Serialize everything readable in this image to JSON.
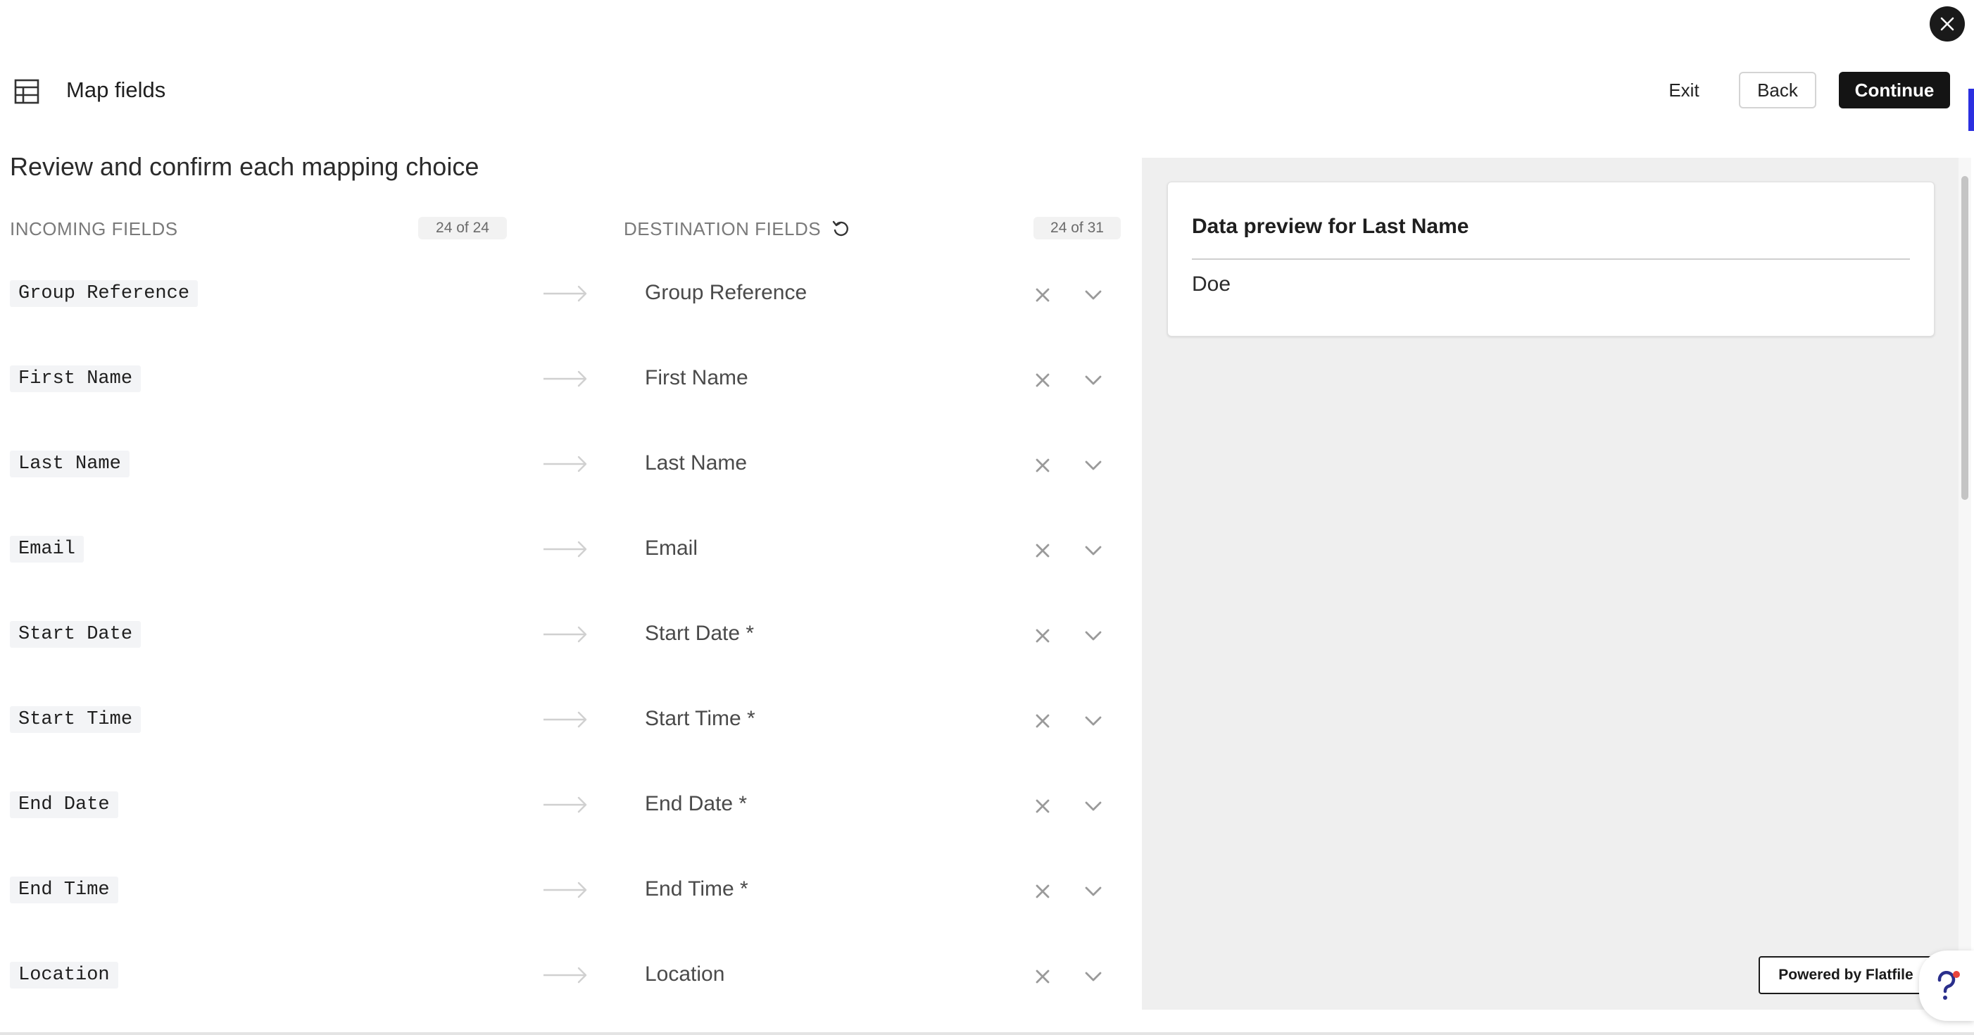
{
  "header": {
    "title": "Map fields",
    "exit_label": "Exit",
    "back_label": "Back",
    "continue_label": "Continue"
  },
  "main": {
    "section_title": "Review and confirm each mapping choice",
    "incoming_header": "INCOMING FIELDS",
    "incoming_count": "24 of 24",
    "destination_header": "DESTINATION FIELDS",
    "destination_count": "24 of 31",
    "rows": [
      {
        "source": "Group Reference",
        "destination": "Group Reference"
      },
      {
        "source": "First Name",
        "destination": "First Name"
      },
      {
        "source": "Last Name",
        "destination": "Last Name"
      },
      {
        "source": "Email",
        "destination": "Email"
      },
      {
        "source": "Start Date",
        "destination": "Start Date *"
      },
      {
        "source": "Start Time",
        "destination": "Start Time *"
      },
      {
        "source": "End Date",
        "destination": "End Date *"
      },
      {
        "source": "End Time",
        "destination": "End Time *"
      },
      {
        "source": "Location",
        "destination": "Location"
      }
    ]
  },
  "preview": {
    "title": "Data preview for Last Name",
    "value": "Doe"
  },
  "footer": {
    "powered_by": "Powered by Flatfile"
  },
  "icons": {
    "close": "close-icon",
    "table": "table-icon",
    "reset": "reset-icon",
    "arrow": "arrow-right-icon",
    "clear": "clear-icon",
    "chevron": "chevron-down-icon",
    "help": "help-icon"
  },
  "colors": {
    "primary_button": "#141414",
    "preview_background": "#efefef",
    "help_badge": "#e8453c"
  }
}
